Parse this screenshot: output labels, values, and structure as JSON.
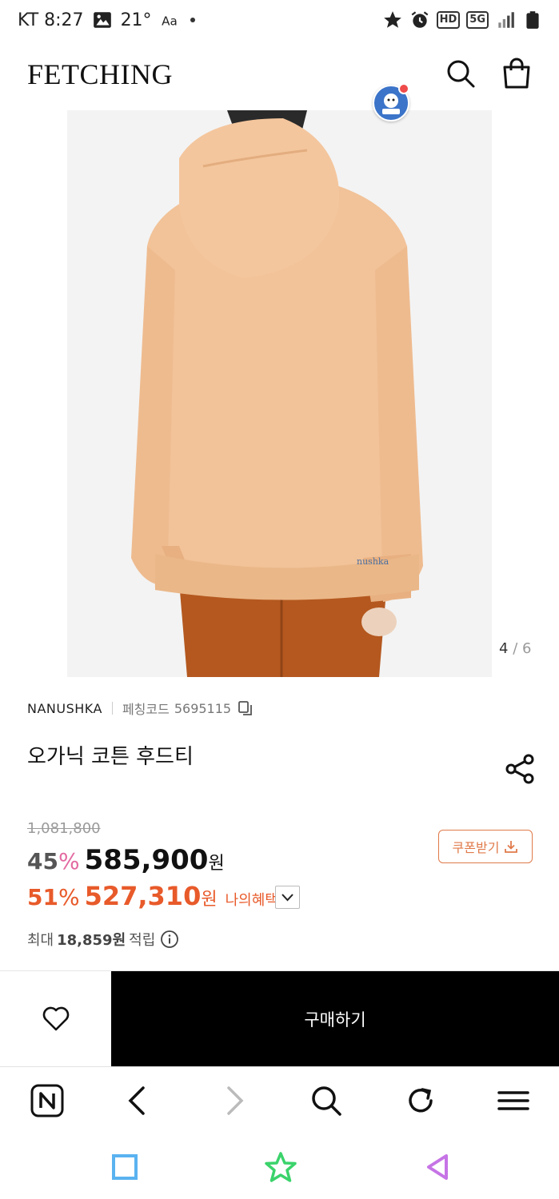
{
  "status_bar": {
    "carrier_time": "KT 8:27",
    "temp": "21°",
    "network": "5G",
    "hd": "HD",
    "battery": "1"
  },
  "header": {
    "logo": "FETCHING"
  },
  "image_counter": {
    "current": "4",
    "sep": "/",
    "total": "6"
  },
  "product": {
    "brand": "NANUSHKA",
    "code_label": "페칭코드",
    "code_value": "5695115",
    "title": "오가닉 코튼 후드티",
    "original_price": "1,081,800",
    "discount_pct": "45",
    "sale_price": "585,900",
    "my_pct": "51",
    "my_price": "527,310",
    "won": "원",
    "pct_sign": "%",
    "my_benefit_label": "나의혜택가",
    "coupon_label": "쿠폰받기",
    "points_prefix": "최대",
    "points_value": "18,859원",
    "points_suffix": "적립"
  },
  "actions": {
    "buy_label": "구매하기"
  },
  "colors": {
    "accent": "#e85a2a",
    "pink": "#e36aa1",
    "hoodie": "#f2c298",
    "pants": "#b4581f"
  }
}
